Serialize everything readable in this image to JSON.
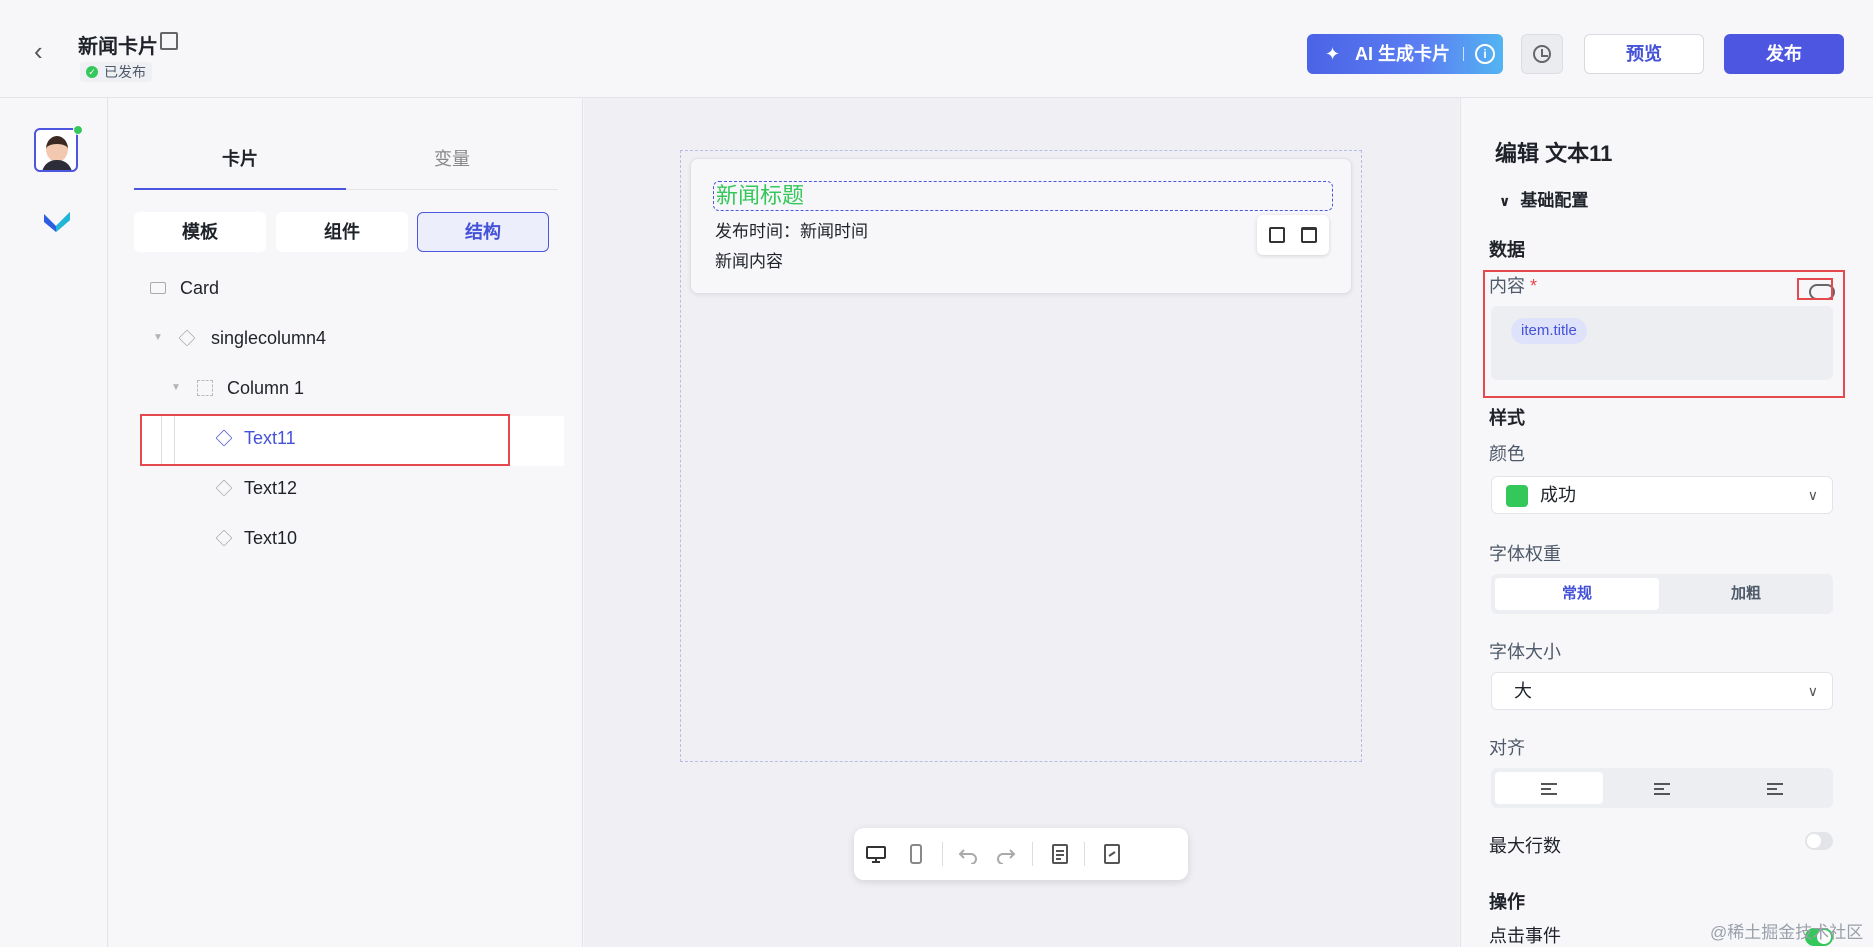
{
  "header": {
    "title": "新闻卡片",
    "status": "已发布",
    "ai_button": "AI 生成卡片",
    "preview": "预览",
    "publish": "发布"
  },
  "left_panel": {
    "tabs": [
      "卡片",
      "变量"
    ],
    "segments": [
      "模板",
      "组件",
      "结构"
    ],
    "tree": [
      {
        "label": "Card"
      },
      {
        "label": "singlecolumn4"
      },
      {
        "label": "Column 1"
      },
      {
        "label": "Text11"
      },
      {
        "label": "Text12"
      },
      {
        "label": "Text10"
      }
    ]
  },
  "canvas": {
    "title": "新闻标题",
    "time": "发布时间：新闻时间",
    "content": "新闻内容"
  },
  "props": {
    "title": "编辑 文本11",
    "section": "基础配置",
    "data_heading": "数据",
    "content_label": "内容",
    "required_mark": "*",
    "content_value": "item.title",
    "style_heading": "样式",
    "color_label": "颜色",
    "color_value": "成功",
    "color_swatch": "#34c759",
    "weight_label": "字体权重",
    "weight_options": [
      "常规",
      "加粗"
    ],
    "size_label": "字体大小",
    "size_value": "大",
    "align_label": "对齐",
    "max_lines_label": "最大行数",
    "action_heading": "操作",
    "click_label": "点击事件"
  },
  "watermark": "@稀土掘金技术社区",
  "colors": {
    "accent": "#4c56e0",
    "success": "#34c759",
    "highlight": "#e5484d"
  }
}
